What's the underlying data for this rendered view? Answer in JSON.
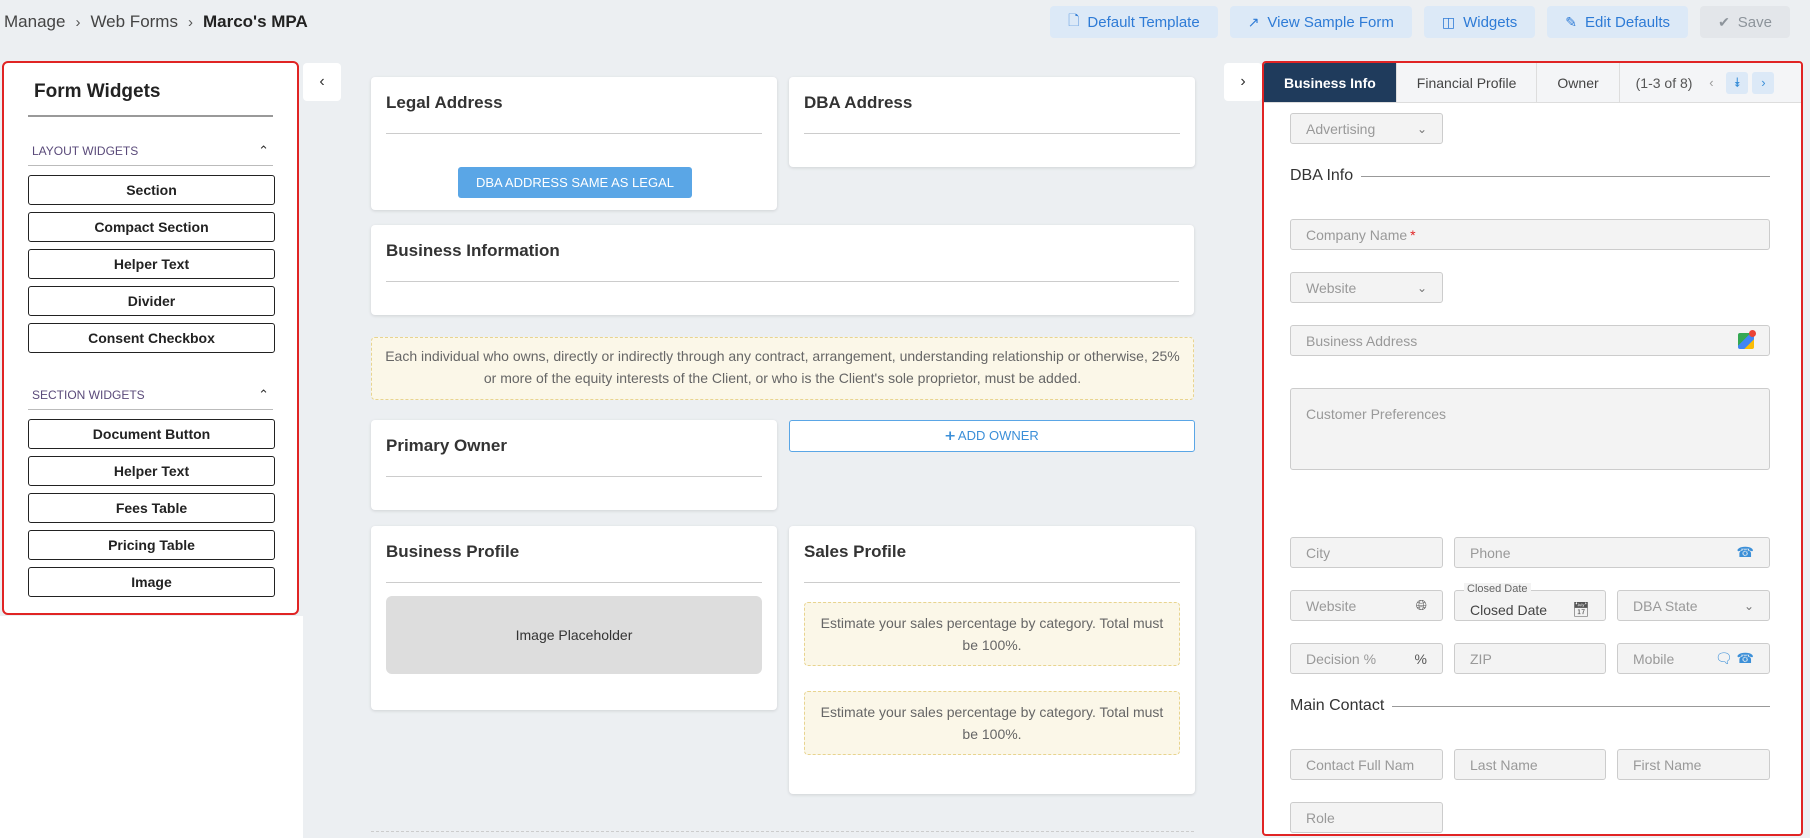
{
  "breadcrumb": {
    "items": [
      "Manage",
      "Web Forms"
    ],
    "current": "Marco's MPA"
  },
  "toolbar": {
    "default_template": "Default Template",
    "view_sample_form": "View Sample Form",
    "widgets": "Widgets",
    "edit_defaults": "Edit Defaults",
    "save": "Save"
  },
  "left_panel": {
    "title": "Form Widgets",
    "layout_widgets_label": "LAYOUT WIDGETS",
    "layout_widgets": [
      "Section",
      "Compact Section",
      "Helper Text",
      "Divider",
      "Consent Checkbox"
    ],
    "section_widgets_label": "SECTION WIDGETS",
    "section_widgets": [
      "Document Button",
      "Helper Text",
      "Fees Table",
      "Pricing Table",
      "Image"
    ]
  },
  "canvas": {
    "legal_address": "Legal Address",
    "dba_same_button": "DBA ADDRESS SAME AS LEGAL",
    "dba_address": "DBA Address",
    "business_information": "Business Information",
    "owner_notice": "Each individual who owns, directly or indirectly through any contract, arrangement, understanding relationship or otherwise, 25% or more of the equity interests of the Client, or who is the Client's sole proprietor, must be added.",
    "primary_owner": "Primary Owner",
    "add_owner": "ADD OWNER",
    "business_profile": "Business Profile",
    "image_placeholder": "Image Placeholder",
    "sales_profile": "Sales Profile",
    "sales_note_1": "Estimate your sales percentage by category. Total must be 100%.",
    "sales_note_2": "Estimate your sales percentage by category. Total must be 100%."
  },
  "right_panel": {
    "tabs": [
      "Business Info",
      "Financial Profile",
      "Owner"
    ],
    "tab_count": "(1-3 of 8)",
    "fields": {
      "advertising": "Advertising",
      "dba_info": "DBA Info",
      "company_name": "Company Name",
      "website_select": "Website",
      "business_address": "Business Address",
      "customer_preferences": "Customer Preferences",
      "city": "City",
      "phone": "Phone",
      "website": "Website",
      "closed_date_label": "Closed Date",
      "closed_date": "Closed Date",
      "dba_state": "DBA State",
      "decision_pct": "Decision %",
      "zip": "ZIP",
      "mobile": "Mobile",
      "main_contact": "Main Contact",
      "contact_full_name": "Contact Full Nam",
      "last_name": "Last Name",
      "first_name": "First Name",
      "role": "Role"
    }
  },
  "colors": {
    "accent": "#2e7bd6",
    "highlight_border": "#e02424",
    "active_tab": "#1f3b5c",
    "notice_bg": "#fbf7e8"
  }
}
